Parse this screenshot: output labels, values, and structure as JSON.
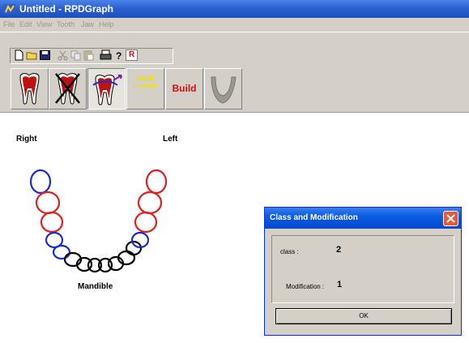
{
  "window": {
    "title": "Untitled - RPDGraph"
  },
  "menu": [
    "File",
    "Edit",
    "View",
    "Tooth",
    "Jaw",
    "Help"
  ],
  "toolbar": {
    "r_label": "R",
    "build_label": "Build",
    "yellow_label": "Set all implants"
  },
  "arch": {
    "right_label": "Right",
    "left_label": "Left",
    "jaw_label": "Mandible",
    "colors": {
      "red": "#e02020",
      "blue": "#1a2ecc",
      "black": "#000000"
    }
  },
  "dialog": {
    "title": "Class and Modification",
    "class_label": "class :",
    "class_value": "2",
    "modification_label": "Modification :",
    "modification_value": "1",
    "ok_label": "OK"
  }
}
